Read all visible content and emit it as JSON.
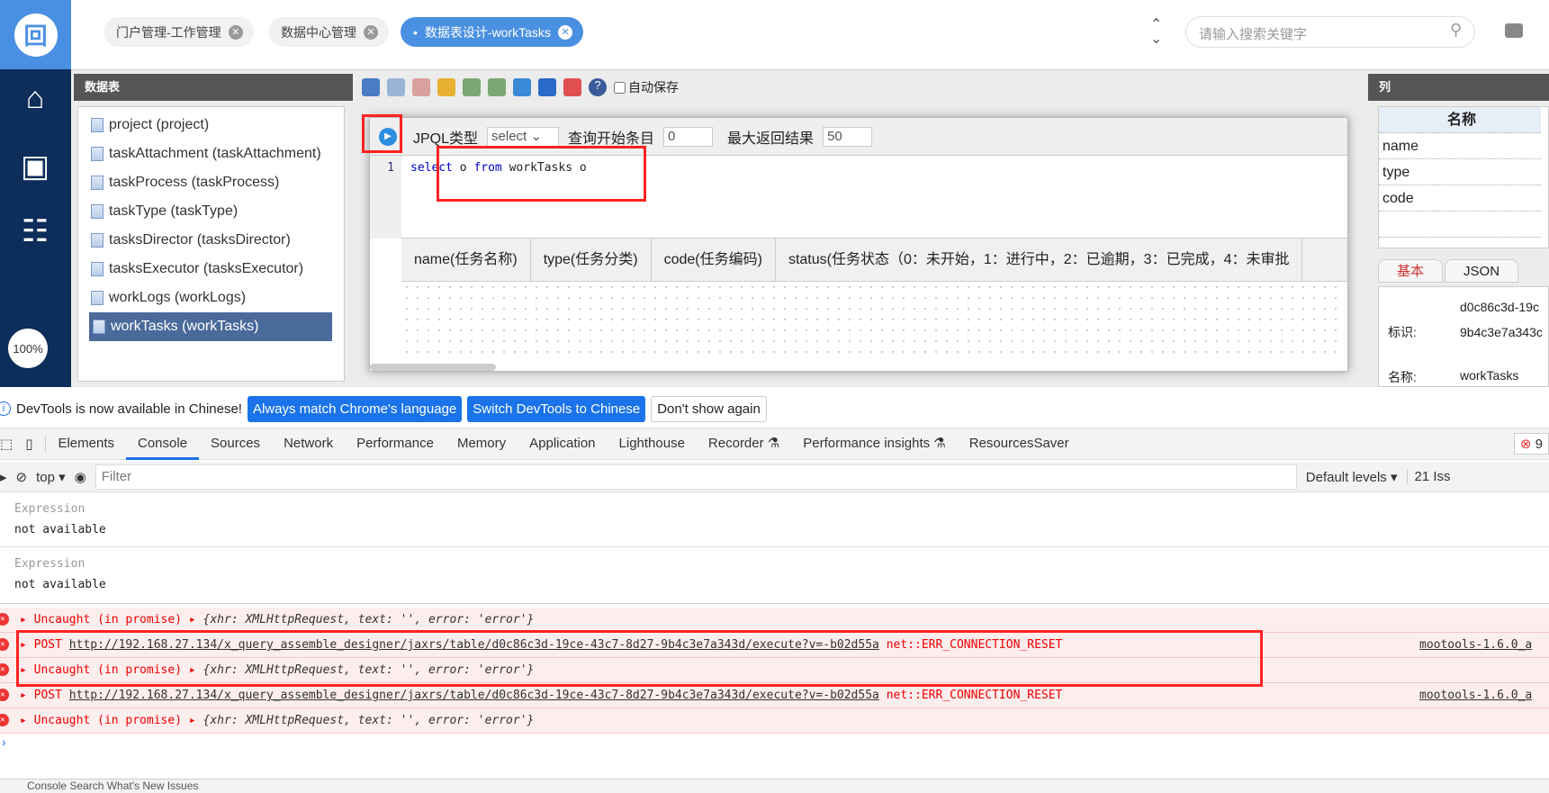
{
  "app": {
    "zoom": "100%",
    "search_placeholder": "请输入搜索关键字"
  },
  "tabs": [
    {
      "label": "门户管理-工作管理"
    },
    {
      "label": "数据中心管理"
    },
    {
      "label": "数据表设计-workTasks"
    }
  ],
  "left_panel": {
    "title": "数据表",
    "items": [
      "project (project)",
      "taskAttachment (taskAttachment)",
      "taskProcess (taskProcess)",
      "taskType (taskType)",
      "tasksDirector (tasksDirector)",
      "tasksExecutor (tasksExecutor)",
      "workLogs (workLogs)",
      "workTasks (workTasks)"
    ]
  },
  "toolbar": {
    "autosave_label": "自动保存"
  },
  "query": {
    "type_label": "JPQL类型",
    "type_value": "select",
    "start_label": "查询开始条目",
    "start_value": "0",
    "max_label": "最大返回结果",
    "max_value": "50",
    "line_no": "1",
    "code_kw1": "select",
    "code_mid": " o ",
    "code_kw2": "from",
    "code_rest": " workTasks o"
  },
  "result_columns": [
    "name(任务名称)",
    "type(任务分类)",
    "code(任务编码)",
    "status(任务状态（0：未开始，1：进行中，2：已逾期，3：已完成，4：未审批"
  ],
  "right_panel": {
    "title": "列",
    "col_header": "名称",
    "rows": [
      "name",
      "type",
      "code",
      ""
    ],
    "tabs": [
      "基本",
      "JSON"
    ],
    "id_label": "标识:",
    "id_value1": "d0c86c3d-19c",
    "id_value2": "9b4c3e7a343c",
    "name_label": "名称:",
    "name_value": "workTasks"
  },
  "devtools": {
    "info": "DevTools is now available in Chinese!",
    "btn_match": "Always match Chrome's language",
    "btn_switch": "Switch DevTools to Chinese",
    "btn_dont": "Don't show again",
    "tabs": [
      "Elements",
      "Console",
      "Sources",
      "Network",
      "Performance",
      "Memory",
      "Application",
      "Lighthouse",
      "Recorder ⚗",
      "Performance insights ⚗",
      "ResourcesSaver"
    ],
    "error_count": "9",
    "context": "top",
    "filter_placeholder": "Filter",
    "levels": "Default levels",
    "issues": "21 Iss",
    "expr_label": "Expression",
    "expr_value": "not available",
    "uncaught": "Uncaught (in promise)",
    "obj_text": "{xhr: XMLHttpRequest, text: '', error: 'error'}",
    "post": "POST",
    "url": "http://192.168.27.134/x_query_assemble_designer/jaxrs/table/d0c86c3d-19ce-43c7-8d27-9b4c3e7a343d/execute?v=-b02d55a",
    "net_err": "net::ERR_CONNECTION_RESET",
    "source": "mootools-1.6.0_a",
    "bottom": "Console  Search  What's New  Issues"
  }
}
